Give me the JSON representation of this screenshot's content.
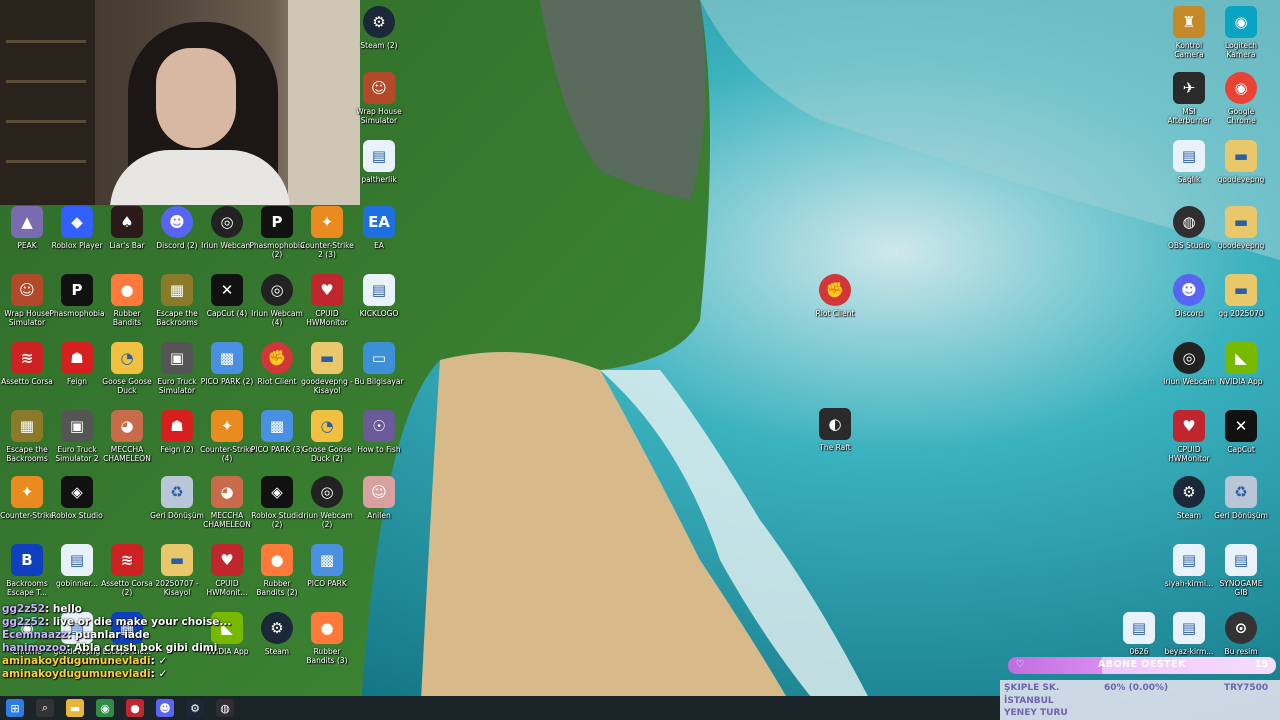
{
  "webcam": {
    "label": "webcam"
  },
  "desktop_icons": [
    {
      "id": "steam-top",
      "label": "Steam (2)",
      "icon": "steam-icon",
      "color": "#1b2838",
      "glyph": "⚙"
    },
    {
      "id": "wrap-house-1",
      "label": "Wrap House Simulator",
      "icon": "game-icon",
      "color": "#b24a2a",
      "glyph": "☺"
    },
    {
      "id": "paltherlik",
      "label": "paltherlik",
      "icon": "file-icon",
      "color": "#e9f1fb",
      "glyph": "▤"
    },
    {
      "id": "peak",
      "label": "PEAK",
      "icon": "game-icon",
      "color": "#7a6bb0",
      "glyph": "▲"
    },
    {
      "id": "roblox-player",
      "label": "Roblox Player",
      "icon": "roblox-icon",
      "color": "#335fff",
      "glyph": "◆"
    },
    {
      "id": "liars-bar",
      "label": "Liar's Bar",
      "icon": "game-icon",
      "color": "#2a1a1a",
      "glyph": "♠"
    },
    {
      "id": "discord-2",
      "label": "Discord (2)",
      "icon": "discord-icon",
      "color": "#5865f2",
      "glyph": "☻"
    },
    {
      "id": "iriun-webcam",
      "label": "Iriun Webcam",
      "icon": "webcam-icon",
      "color": "#222",
      "glyph": "◎"
    },
    {
      "id": "phasmophobia-2",
      "label": "Phasmophobia (2)",
      "icon": "game-icon",
      "color": "#111",
      "glyph": "P"
    },
    {
      "id": "counter-strike-3",
      "label": "Counter-Strike 2 (3)",
      "icon": "cs-icon",
      "color": "#e98b1f",
      "glyph": "✦"
    },
    {
      "id": "ea",
      "label": "EA",
      "icon": "ea-icon",
      "color": "#1e6fe0",
      "glyph": "EA"
    },
    {
      "id": "wrap-house-2",
      "label": "Wrap House Simulator",
      "icon": "game-icon",
      "color": "#b24a2a",
      "glyph": "☺"
    },
    {
      "id": "phasmophobia",
      "label": "Phasmophobia",
      "icon": "game-icon",
      "color": "#111",
      "glyph": "P"
    },
    {
      "id": "rubber-bandits",
      "label": "Rubber Bandits",
      "icon": "game-icon",
      "color": "#ff7a3a",
      "glyph": "●"
    },
    {
      "id": "escape-backrooms",
      "label": "Escape the Backrooms",
      "icon": "game-icon",
      "color": "#8b7a2a",
      "glyph": "▦"
    },
    {
      "id": "capcut-4",
      "label": "CapCut (4)",
      "icon": "capcut-icon",
      "color": "#111",
      "glyph": "✕"
    },
    {
      "id": "iriun-webcam-4",
      "label": "Iriun Webcam (4)",
      "icon": "webcam-icon",
      "color": "#222",
      "glyph": "◎"
    },
    {
      "id": "cpuid-hwmonitor",
      "label": "CPUID HWMonitor",
      "icon": "hwmonitor-icon",
      "color": "#c0262e",
      "glyph": "♥"
    },
    {
      "id": "kick-logo",
      "label": "KICKLOGO",
      "icon": "file-icon",
      "color": "#e9f1fb",
      "glyph": "▤"
    },
    {
      "id": "riot-client-right",
      "label": "Riot Client",
      "icon": "riot-icon",
      "color": "#d13639",
      "glyph": "✊"
    },
    {
      "id": "assetto-corsa",
      "label": "Assetto Corsa",
      "icon": "game-icon",
      "color": "#c22",
      "glyph": "≋"
    },
    {
      "id": "feign",
      "label": "Feign",
      "icon": "game-icon",
      "color": "#d62020",
      "glyph": "☗"
    },
    {
      "id": "goose-goose-duck",
      "label": "Goose Goose Duck",
      "icon": "game-icon",
      "color": "#f1c040",
      "glyph": "◔"
    },
    {
      "id": "euro-truck",
      "label": "Euro Truck Simulator",
      "icon": "game-icon",
      "color": "#555",
      "glyph": "▣"
    },
    {
      "id": "pico-park-2",
      "label": "PICO PARK (2)",
      "icon": "game-icon",
      "color": "#4a90e2",
      "glyph": "▩"
    },
    {
      "id": "riot-client",
      "label": "Riot Client",
      "icon": "riot-icon",
      "color": "#d13639",
      "glyph": "✊"
    },
    {
      "id": "goodevepng",
      "label": "goodevepng - Kisayol",
      "icon": "folder-icon",
      "color": "#e8c86a",
      "glyph": "▬"
    },
    {
      "id": "bd-bilgisayar",
      "label": "Bu Bilgisayar",
      "icon": "computer-icon",
      "color": "#3d8fd6",
      "glyph": "▭"
    },
    {
      "id": "escape-backrooms-2",
      "label": "Escape the Backrooms",
      "icon": "game-icon",
      "color": "#8b7a2a",
      "glyph": "▦"
    },
    {
      "id": "euro-truck-2",
      "label": "Euro Truck Simulator 2",
      "icon": "game-icon",
      "color": "#555",
      "glyph": "▣"
    },
    {
      "id": "meccha-chameleon",
      "label": "MECCHA CHAMELEON",
      "icon": "game-icon",
      "color": "#c96b4a",
      "glyph": "◕"
    },
    {
      "id": "feign-2",
      "label": "Feign (2)",
      "icon": "game-icon",
      "color": "#d62020",
      "glyph": "☗"
    },
    {
      "id": "counter-strike-4",
      "label": "Counter-Strike (4)",
      "icon": "cs-icon",
      "color": "#e98b1f",
      "glyph": "✦"
    },
    {
      "id": "pico-park-3",
      "label": "PICO PARK (3)",
      "icon": "game-icon",
      "color": "#4a90e2",
      "glyph": "▩"
    },
    {
      "id": "goose-goose-duck-2",
      "label": "Goose Goose Duck (2)",
      "icon": "game-icon",
      "color": "#f1c040",
      "glyph": "◔"
    },
    {
      "id": "how-to-fish",
      "label": "How to Fish",
      "icon": "game-icon",
      "color": "#6a5a9a",
      "glyph": "☉"
    },
    {
      "id": "counter-strike",
      "label": "Counter-Strike",
      "icon": "cs-icon",
      "color": "#e98b1f",
      "glyph": "✦"
    },
    {
      "id": "roblox-studio",
      "label": "Roblox Studio",
      "icon": "roblox-icon",
      "color": "#111",
      "glyph": "◈"
    },
    {
      "id": "geri-donusum",
      "label": "Geri Dönüşüm",
      "icon": "recycle-icon",
      "color": "#b8c6d8",
      "glyph": "♻"
    },
    {
      "id": "meccha-chameleon-2",
      "label": "MECCHA CHAMELEON",
      "icon": "game-icon",
      "color": "#c96b4a",
      "glyph": "◕"
    },
    {
      "id": "roblox-studio-2",
      "label": "Roblox Studio (2)",
      "icon": "roblox-icon",
      "color": "#111",
      "glyph": "◈"
    },
    {
      "id": "iriun-webcam-2",
      "label": "Iriun Webcam (2)",
      "icon": "webcam-icon",
      "color": "#222",
      "glyph": "◎"
    },
    {
      "id": "anilen",
      "label": "Anilen",
      "icon": "game-icon",
      "color": "#d9a0a0",
      "glyph": "☺"
    },
    {
      "id": "backrooms-escape",
      "label": "Backrooms Escape T...",
      "icon": "game-icon",
      "color": "#1040c0",
      "glyph": "B"
    },
    {
      "id": "gobinnier",
      "label": "gobinnier...",
      "icon": "file-icon",
      "color": "#e9f1fb",
      "glyph": "▤"
    },
    {
      "id": "assetto-corsa-2",
      "label": "Assetto Corsa (2)",
      "icon": "game-icon",
      "color": "#c22",
      "glyph": "≋"
    },
    {
      "id": "kisayol",
      "label": "20250707 - Kisayol",
      "icon": "folder-icon",
      "color": "#e8c86a",
      "glyph": "▬"
    },
    {
      "id": "cpuid-hwmonitor-2",
      "label": "CPUID HWMonit...",
      "icon": "hwmonitor-icon",
      "color": "#c0262e",
      "glyph": "♥"
    },
    {
      "id": "rubber-bandits-2",
      "label": "Rubber Bandits (2)",
      "icon": "game-icon",
      "color": "#ff7a3a",
      "glyph": "●"
    },
    {
      "id": "pico-park",
      "label": "PICO PARK",
      "icon": "game-icon",
      "color": "#4a90e2",
      "glyph": "▩"
    },
    {
      "id": "chrome-left",
      "label": "Chrome",
      "icon": "chrome-icon",
      "color": "#2f8d46",
      "glyph": "◉"
    },
    {
      "id": "escape-the",
      "label": "Escape the...",
      "icon": "game-icon",
      "color": "#1040c0",
      "glyph": "▦"
    },
    {
      "id": "goodevepng-2",
      "label": "goodevepng Kisayol",
      "icon": "file-icon",
      "color": "#e9f1fb",
      "glyph": "▤"
    },
    {
      "id": "nvidia-app",
      "label": "NVIDIA App",
      "icon": "nvidia-icon",
      "color": "#76b900",
      "glyph": "◣"
    },
    {
      "id": "steam-bottom",
      "label": "Steam",
      "icon": "steam-icon",
      "color": "#1b2838",
      "glyph": "⚙"
    },
    {
      "id": "rubber-bandits-3",
      "label": "Rubber Bandits (3)",
      "icon": "game-icon",
      "color": "#ff7a3a",
      "glyph": "●"
    },
    {
      "id": "the-raft",
      "label": "The Raft",
      "icon": "game-icon",
      "color": "#2a2a2a",
      "glyph": "◐"
    },
    {
      "id": "kontrol-camera",
      "label": "Kontrol Camera",
      "icon": "game-icon",
      "color": "#c6892a",
      "glyph": "♜"
    },
    {
      "id": "logitech-camera",
      "label": "Logitech Kamera",
      "icon": "camera-icon",
      "color": "#0aa3c2",
      "glyph": "◉"
    },
    {
      "id": "msi-afterburner",
      "label": "MSI Afterburner",
      "icon": "afterburner-icon",
      "color": "#2a2a2a",
      "glyph": "✈"
    },
    {
      "id": "google-chrome",
      "label": "Google Chrome",
      "icon": "chrome-icon",
      "color": "#ea4335",
      "glyph": "◉"
    },
    {
      "id": "file-r1",
      "label": "Sağlık",
      "icon": "file-icon",
      "color": "#e9f1fb",
      "glyph": "▤"
    },
    {
      "id": "folder-r1",
      "label": "goodevepng",
      "icon": "folder-icon",
      "color": "#e8c86a",
      "glyph": "▬"
    },
    {
      "id": "obs-studio",
      "label": "OBS Studio",
      "icon": "obs-icon",
      "color": "#302e31",
      "glyph": "◍"
    },
    {
      "id": "folder-r2",
      "label": "goodevepng",
      "icon": "folder-icon",
      "color": "#e8c86a",
      "glyph": "▬"
    },
    {
      "id": "discord-right",
      "label": "Discord",
      "icon": "discord-icon",
      "color": "#5865f2",
      "glyph": "☻"
    },
    {
      "id": "folder-r3",
      "label": "gg 2025070",
      "icon": "folder-icon",
      "color": "#e8c86a",
      "glyph": "▬"
    },
    {
      "id": "iriun-right",
      "label": "Iriun Webcam",
      "icon": "webcam-icon",
      "color": "#222",
      "glyph": "◎"
    },
    {
      "id": "nvidia-right",
      "label": "NVIDIA App",
      "icon": "nvidia-icon",
      "color": "#76b900",
      "glyph": "◣"
    },
    {
      "id": "cpuid-right",
      "label": "CPUID HWMonitor",
      "icon": "hwmonitor-icon",
      "color": "#c0262e",
      "glyph": "♥"
    },
    {
      "id": "capcut-right",
      "label": "CapCut",
      "icon": "capcut-icon",
      "color": "#111",
      "glyph": "✕"
    },
    {
      "id": "steam-right",
      "label": "Steam",
      "icon": "steam-icon",
      "color": "#1b2838",
      "glyph": "⚙"
    },
    {
      "id": "recycle-right",
      "label": "Geri Dönüşüm",
      "icon": "recycle-icon",
      "color": "#b8c6d8",
      "glyph": "♻"
    },
    {
      "id": "siyah-kirmizi",
      "label": "siyah-kirmi...",
      "icon": "file-icon",
      "color": "#e9f1fb",
      "glyph": "▤"
    },
    {
      "id": "synonyms",
      "label": "SYNOGAME GIB",
      "icon": "file-icon",
      "color": "#e9f1fb",
      "glyph": "▤"
    },
    {
      "id": "file-bottom-1",
      "label": "0626",
      "icon": "file-icon",
      "color": "#e9f1fb",
      "glyph": "▤"
    },
    {
      "id": "beyaz-kirmizi",
      "label": "beyaz-kirm...",
      "icon": "file-icon",
      "color": "#e9f1fb",
      "glyph": "▤"
    },
    {
      "id": "bu-resim",
      "label": "Bu resim hakkında",
      "icon": "info-icon",
      "color": "#333",
      "glyph": "⊙"
    }
  ],
  "chat": [
    {
      "user": "gg2z52",
      "text": ": hello"
    },
    {
      "user": "gg2z52",
      "text": ": live or die make your choise..."
    },
    {
      "user": "Ecemnaazz",
      "text": ": puanlar iade"
    },
    {
      "user": "hanimozoo",
      "text": ": Abla crush bok gibi dimi"
    },
    {
      "user": "aminakoydugumunevladi",
      "text": ": ✓"
    },
    {
      "user": "aminakoydugumunevladi",
      "text": ": ✓"
    }
  ],
  "goal": {
    "text": "ABONE DESTEK",
    "count": "15",
    "progress": 0.35,
    "mark": "♡"
  },
  "ticker": {
    "line1": "ŞKIPLE SK.",
    "line2": "İSTANBUL",
    "line3": "60% (0.00%)",
    "line4": "TRY7500",
    "line5": "YENEY TURU"
  },
  "colors": {
    "sea": "#1aa0b0",
    "goal": "#d98cf0",
    "taskbar": "#1b2428"
  },
  "taskbar": {
    "items": [
      {
        "icon": "windows-icon",
        "glyph": "⊞",
        "color": "#2d7de3"
      },
      {
        "icon": "search-icon",
        "glyph": "⌕",
        "color": "#333"
      },
      {
        "icon": "file-explorer-icon",
        "glyph": "▬",
        "color": "#e8b63a"
      },
      {
        "icon": "chrome-icon",
        "glyph": "◉",
        "color": "#2f8d46"
      },
      {
        "icon": "recording-icon",
        "glyph": "●",
        "color": "#c0262e"
      },
      {
        "icon": "discord-icon",
        "glyph": "☻",
        "color": "#5865f2"
      },
      {
        "icon": "steam-icon",
        "glyph": "⚙",
        "color": "#1b2838"
      },
      {
        "icon": "obs-icon",
        "glyph": "◍",
        "color": "#302e31"
      }
    ]
  }
}
